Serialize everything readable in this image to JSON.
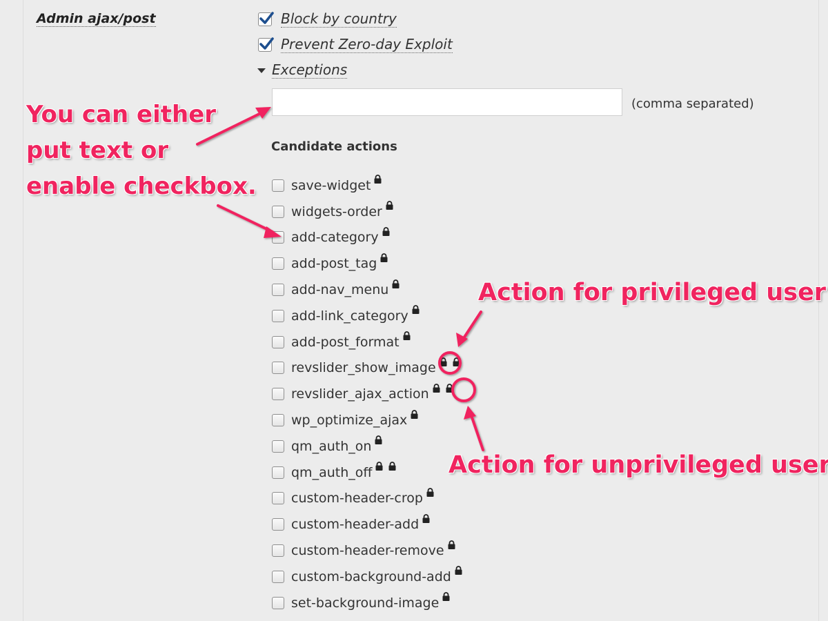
{
  "section": {
    "label": "Admin ajax/post"
  },
  "options": [
    {
      "label": "Block by country",
      "checked": true
    },
    {
      "label": "Prevent Zero-day Exploit",
      "checked": true
    }
  ],
  "exceptions": {
    "label": "Exceptions",
    "value": "",
    "hint": "(comma separated)"
  },
  "candidates": {
    "title": "Candidate actions",
    "actions": [
      {
        "name": "save-widget",
        "locks": 1
      },
      {
        "name": "widgets-order",
        "locks": 1
      },
      {
        "name": "add-category",
        "locks": 1
      },
      {
        "name": "add-post_tag",
        "locks": 1
      },
      {
        "name": "add-nav_menu",
        "locks": 1
      },
      {
        "name": "add-link_category",
        "locks": 1
      },
      {
        "name": "add-post_format",
        "locks": 1
      },
      {
        "name": "revslider_show_image",
        "locks": 2
      },
      {
        "name": "revslider_ajax_action",
        "locks": 2
      },
      {
        "name": "wp_optimize_ajax",
        "locks": 1
      },
      {
        "name": "qm_auth_on",
        "locks": 1
      },
      {
        "name": "qm_auth_off",
        "locks": 2
      },
      {
        "name": "custom-header-crop",
        "locks": 1
      },
      {
        "name": "custom-header-add",
        "locks": 1
      },
      {
        "name": "custom-header-remove",
        "locks": 1
      },
      {
        "name": "custom-background-add",
        "locks": 1
      },
      {
        "name": "set-background-image",
        "locks": 1
      }
    ]
  },
  "annotations": {
    "left": [
      "You can either",
      "put text or",
      "enable checkbox."
    ],
    "privileged": "Action for privileged user",
    "unprivileged": "Action for unprivileged user",
    "color": "#f0245f"
  }
}
